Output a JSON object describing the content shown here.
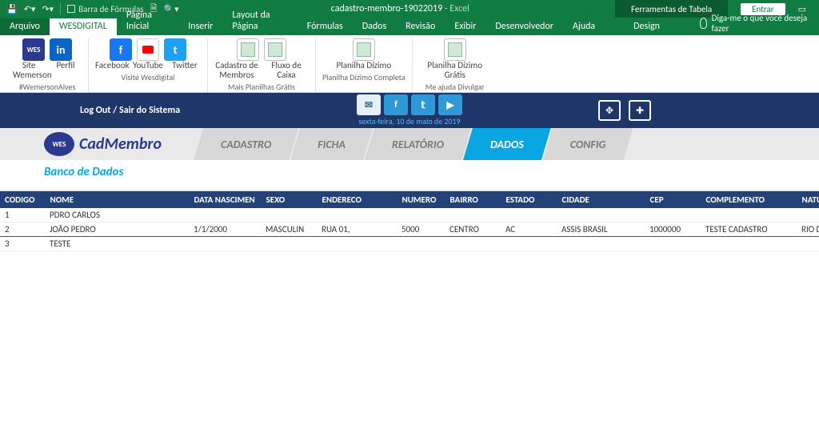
{
  "titlebar": {
    "formula_bar": "Barra de Fórmulas",
    "doc_title": "cadastro-membro-19022019",
    "app_name": "Excel",
    "tools_label": "Ferramentas de Tabela",
    "signin": "Entrar"
  },
  "tabs": {
    "file": "Arquivo",
    "active": "WESDIGITAL",
    "others": [
      "Página Inicial",
      "Inserir",
      "Layout da Página",
      "Fórmulas",
      "Dados",
      "Revisão",
      "Exibir",
      "Desenvolvedor",
      "Ajuda"
    ],
    "design": "Design",
    "tellme": "Diga-me o que você deseja fazer"
  },
  "ribbon": {
    "g1": {
      "labels": [
        "Site Wemerson",
        "Perfil"
      ],
      "caption": "#WemersonAlves"
    },
    "g2": {
      "labels": [
        "Facebook",
        "YouTube",
        "Twitter"
      ],
      "caption": "Visite Wesdigital"
    },
    "g3": {
      "labels": [
        "Cadastro de Membros",
        "Fluxo de Caixa"
      ],
      "caption": "Mais Planilhas Grátis"
    },
    "g4": {
      "labels": [
        "Planilha Dízimo"
      ],
      "caption": "Planilha Dízimo Completa"
    },
    "g5": {
      "labels": [
        "Planilha Dízimo Grátis"
      ],
      "caption": "Me ajuda Divulgar"
    }
  },
  "apphdr": {
    "logout": "Log Out  /  Sair do Sistema",
    "date": "sexta-feira, 10 de maio de 2019"
  },
  "appnav": {
    "brand_logo": "WES",
    "brand_name": "CadMembro",
    "tabs": [
      "CADASTRO",
      "FICHA",
      "RELATÓRIO",
      "DADOS",
      "CONFIG"
    ],
    "active_index": 3
  },
  "subtitle": "Banco de Dados",
  "grid": {
    "headers": [
      "CODIGO",
      "NOME",
      "DATA NASCIMEN",
      "SEXO",
      "ENDERECO",
      "NUMERO",
      "BAIRRO",
      "ESTADO",
      "CIDADE",
      "CEP",
      "COMPLEMENTO",
      "NATURA"
    ],
    "rows": [
      {
        "codigo": "1",
        "nome": "PDRO CARLOS",
        "data": "",
        "sexo": "",
        "end": "",
        "num": "",
        "bairro": "",
        "estado": "",
        "cidade": "",
        "cep": "",
        "comp": "",
        "nat": ""
      },
      {
        "codigo": "2",
        "nome": "JOÃO PEDRO",
        "data": "1/1/2000",
        "sexo": "MASCULIN",
        "end": "RUA 01,",
        "num": "5000",
        "bairro": "CENTRO",
        "estado": "AC",
        "cidade": "ASSIS BRASIL",
        "cep": "1000000",
        "comp": "TESTE CADASTRO",
        "nat": "RIO DE JA",
        "selected": true
      },
      {
        "codigo": "3",
        "nome": "TESTE",
        "data": "",
        "sexo": "",
        "end": "",
        "num": "",
        "bairro": "",
        "estado": "",
        "cidade": "",
        "cep": "",
        "comp": "",
        "nat": ""
      }
    ]
  }
}
